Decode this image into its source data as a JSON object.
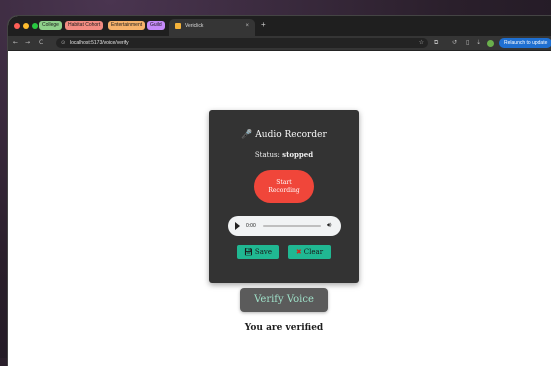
{
  "browser": {
    "tab_groups": [
      {
        "label": "College",
        "color": "#8fd18b"
      },
      {
        "label": "Habitat Cohort",
        "color": "#f28b82"
      },
      {
        "label": "Entertainment",
        "color": "#f6b26b"
      },
      {
        "label": "Guild",
        "color": "#c58af9"
      }
    ],
    "active_tab": {
      "title": "Vericlick",
      "close": "×"
    },
    "new_tab": "+",
    "nav": {
      "back": "←",
      "forward": "→",
      "reload": "C"
    },
    "url": "localhost:5173/voice/verify",
    "relaunch_label": "Relaunch to update"
  },
  "recorder": {
    "title": "🎤 Audio Recorder",
    "status_label": "Status:",
    "status_value": "stopped",
    "record_button": {
      "line1": "Start",
      "line2": "Recording",
      "color": "#f0463a"
    },
    "player": {
      "time": "0:00"
    },
    "save_label": "Save",
    "clear_label": "Clear",
    "accent": "#20b892"
  },
  "verify": {
    "button_label": "Verify Voice",
    "result_text": "You are verified"
  }
}
